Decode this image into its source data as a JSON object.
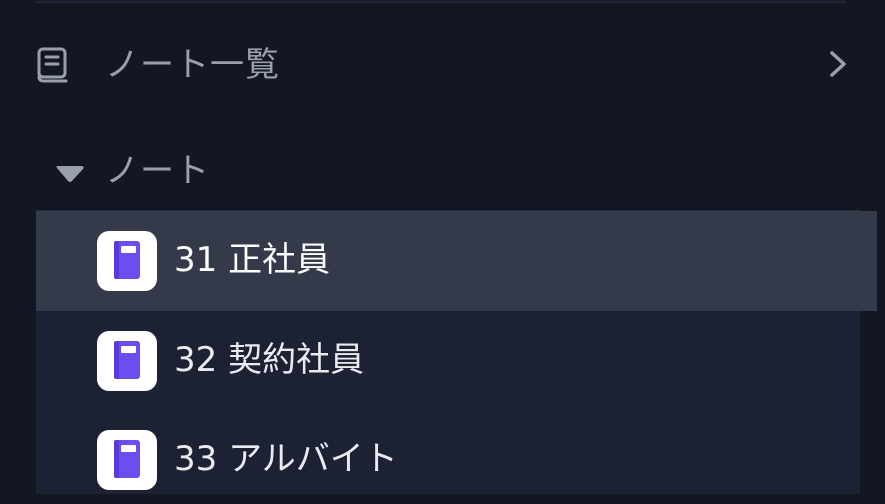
{
  "nav": {
    "notes_list_label": "ノート一覧"
  },
  "section": {
    "label": "ノート"
  },
  "notes": [
    {
      "label": "31 正社員",
      "selected": true
    },
    {
      "label": "32 契約社員",
      "selected": false
    },
    {
      "label": "33 アルバイト",
      "selected": false
    }
  ],
  "colors": {
    "background": "#131722",
    "panel": "#1c2133",
    "selected_row": "#353a4b",
    "notebook_purple": "#6d4cf0",
    "muted_text": "#9aa0ab"
  },
  "icons": {
    "nav": "notebook-outline-icon",
    "nav_chevron": "chevron-right-icon",
    "section_caret": "caret-down-icon",
    "note": "notebook-icon"
  }
}
